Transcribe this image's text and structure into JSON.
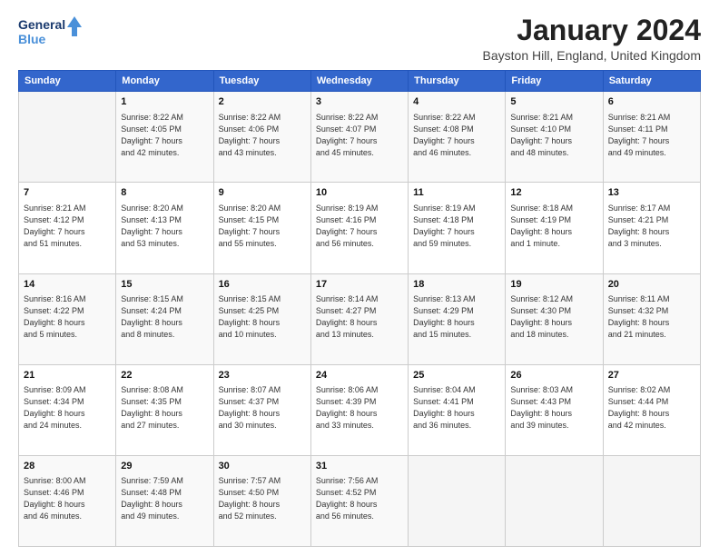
{
  "logo": {
    "line1": "General",
    "line2": "Blue"
  },
  "title": "January 2024",
  "subtitle": "Bayston Hill, England, United Kingdom",
  "weekdays": [
    "Sunday",
    "Monday",
    "Tuesday",
    "Wednesday",
    "Thursday",
    "Friday",
    "Saturday"
  ],
  "weeks": [
    [
      {
        "day": "",
        "info": ""
      },
      {
        "day": "1",
        "info": "Sunrise: 8:22 AM\nSunset: 4:05 PM\nDaylight: 7 hours\nand 42 minutes."
      },
      {
        "day": "2",
        "info": "Sunrise: 8:22 AM\nSunset: 4:06 PM\nDaylight: 7 hours\nand 43 minutes."
      },
      {
        "day": "3",
        "info": "Sunrise: 8:22 AM\nSunset: 4:07 PM\nDaylight: 7 hours\nand 45 minutes."
      },
      {
        "day": "4",
        "info": "Sunrise: 8:22 AM\nSunset: 4:08 PM\nDaylight: 7 hours\nand 46 minutes."
      },
      {
        "day": "5",
        "info": "Sunrise: 8:21 AM\nSunset: 4:10 PM\nDaylight: 7 hours\nand 48 minutes."
      },
      {
        "day": "6",
        "info": "Sunrise: 8:21 AM\nSunset: 4:11 PM\nDaylight: 7 hours\nand 49 minutes."
      }
    ],
    [
      {
        "day": "7",
        "info": "Sunrise: 8:21 AM\nSunset: 4:12 PM\nDaylight: 7 hours\nand 51 minutes."
      },
      {
        "day": "8",
        "info": "Sunrise: 8:20 AM\nSunset: 4:13 PM\nDaylight: 7 hours\nand 53 minutes."
      },
      {
        "day": "9",
        "info": "Sunrise: 8:20 AM\nSunset: 4:15 PM\nDaylight: 7 hours\nand 55 minutes."
      },
      {
        "day": "10",
        "info": "Sunrise: 8:19 AM\nSunset: 4:16 PM\nDaylight: 7 hours\nand 56 minutes."
      },
      {
        "day": "11",
        "info": "Sunrise: 8:19 AM\nSunset: 4:18 PM\nDaylight: 7 hours\nand 59 minutes."
      },
      {
        "day": "12",
        "info": "Sunrise: 8:18 AM\nSunset: 4:19 PM\nDaylight: 8 hours\nand 1 minute."
      },
      {
        "day": "13",
        "info": "Sunrise: 8:17 AM\nSunset: 4:21 PM\nDaylight: 8 hours\nand 3 minutes."
      }
    ],
    [
      {
        "day": "14",
        "info": "Sunrise: 8:16 AM\nSunset: 4:22 PM\nDaylight: 8 hours\nand 5 minutes."
      },
      {
        "day": "15",
        "info": "Sunrise: 8:15 AM\nSunset: 4:24 PM\nDaylight: 8 hours\nand 8 minutes."
      },
      {
        "day": "16",
        "info": "Sunrise: 8:15 AM\nSunset: 4:25 PM\nDaylight: 8 hours\nand 10 minutes."
      },
      {
        "day": "17",
        "info": "Sunrise: 8:14 AM\nSunset: 4:27 PM\nDaylight: 8 hours\nand 13 minutes."
      },
      {
        "day": "18",
        "info": "Sunrise: 8:13 AM\nSunset: 4:29 PM\nDaylight: 8 hours\nand 15 minutes."
      },
      {
        "day": "19",
        "info": "Sunrise: 8:12 AM\nSunset: 4:30 PM\nDaylight: 8 hours\nand 18 minutes."
      },
      {
        "day": "20",
        "info": "Sunrise: 8:11 AM\nSunset: 4:32 PM\nDaylight: 8 hours\nand 21 minutes."
      }
    ],
    [
      {
        "day": "21",
        "info": "Sunrise: 8:09 AM\nSunset: 4:34 PM\nDaylight: 8 hours\nand 24 minutes."
      },
      {
        "day": "22",
        "info": "Sunrise: 8:08 AM\nSunset: 4:35 PM\nDaylight: 8 hours\nand 27 minutes."
      },
      {
        "day": "23",
        "info": "Sunrise: 8:07 AM\nSunset: 4:37 PM\nDaylight: 8 hours\nand 30 minutes."
      },
      {
        "day": "24",
        "info": "Sunrise: 8:06 AM\nSunset: 4:39 PM\nDaylight: 8 hours\nand 33 minutes."
      },
      {
        "day": "25",
        "info": "Sunrise: 8:04 AM\nSunset: 4:41 PM\nDaylight: 8 hours\nand 36 minutes."
      },
      {
        "day": "26",
        "info": "Sunrise: 8:03 AM\nSunset: 4:43 PM\nDaylight: 8 hours\nand 39 minutes."
      },
      {
        "day": "27",
        "info": "Sunrise: 8:02 AM\nSunset: 4:44 PM\nDaylight: 8 hours\nand 42 minutes."
      }
    ],
    [
      {
        "day": "28",
        "info": "Sunrise: 8:00 AM\nSunset: 4:46 PM\nDaylight: 8 hours\nand 46 minutes."
      },
      {
        "day": "29",
        "info": "Sunrise: 7:59 AM\nSunset: 4:48 PM\nDaylight: 8 hours\nand 49 minutes."
      },
      {
        "day": "30",
        "info": "Sunrise: 7:57 AM\nSunset: 4:50 PM\nDaylight: 8 hours\nand 52 minutes."
      },
      {
        "day": "31",
        "info": "Sunrise: 7:56 AM\nSunset: 4:52 PM\nDaylight: 8 hours\nand 56 minutes."
      },
      {
        "day": "",
        "info": ""
      },
      {
        "day": "",
        "info": ""
      },
      {
        "day": "",
        "info": ""
      }
    ]
  ]
}
